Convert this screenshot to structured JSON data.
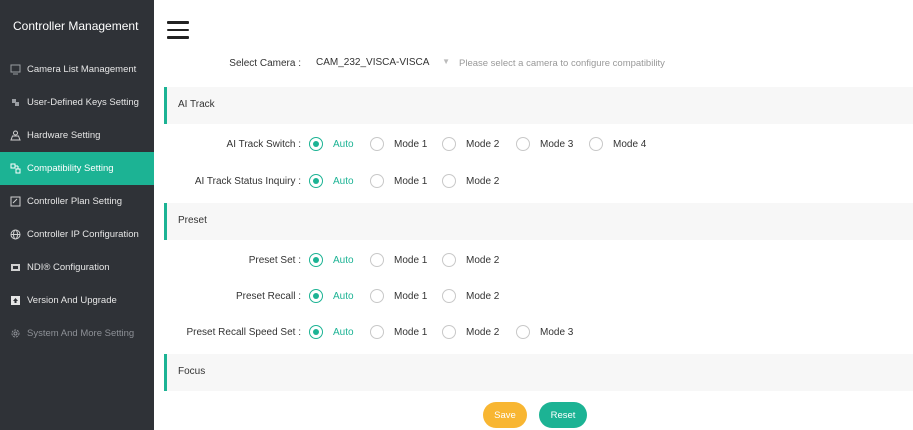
{
  "sidebar": {
    "title": "Controller Management",
    "items": [
      {
        "label": "Camera List Management",
        "icon": "camera-list-icon"
      },
      {
        "label": "User-Defined Keys Setting",
        "icon": "keys-icon"
      },
      {
        "label": "Hardware Setting",
        "icon": "hardware-icon"
      },
      {
        "label": "Compatibility Setting",
        "icon": "compatibility-icon",
        "active": true
      },
      {
        "label": "Controller Plan Setting",
        "icon": "plan-icon"
      },
      {
        "label": "Controller IP Configuration",
        "icon": "ip-icon"
      },
      {
        "label": "NDI® Configuration",
        "icon": "ndi-icon"
      },
      {
        "label": "Version And Upgrade",
        "icon": "upgrade-icon"
      },
      {
        "label": "System And More Setting",
        "icon": "gear-icon"
      }
    ]
  },
  "camera": {
    "label": "Select Camera :",
    "value": "CAM_232_VISCA-VISCA",
    "hint": "Please select a camera to configure compatibility"
  },
  "sections": {
    "ai_track": "AI Track",
    "preset": "Preset",
    "focus": "Focus"
  },
  "rows": {
    "ai_track_switch": {
      "label": "AI Track Switch :",
      "options": [
        "Auto",
        "Mode 1",
        "Mode 2",
        "Mode 3",
        "Mode 4"
      ],
      "selected": "Auto"
    },
    "ai_track_status": {
      "label": "AI Track Status Inquiry :",
      "options": [
        "Auto",
        "Mode 1",
        "Mode 2"
      ],
      "selected": "Auto"
    },
    "preset_set": {
      "label": "Preset Set :",
      "options": [
        "Auto",
        "Mode 1",
        "Mode 2"
      ],
      "selected": "Auto"
    },
    "preset_recall": {
      "label": "Preset Recall :",
      "options": [
        "Auto",
        "Mode 1",
        "Mode 2"
      ],
      "selected": "Auto"
    },
    "preset_recall_speed": {
      "label": "Preset Recall Speed Set :",
      "options": [
        "Auto",
        "Mode 1",
        "Mode 2",
        "Mode 3"
      ],
      "selected": "Auto"
    }
  },
  "buttons": {
    "save": "Save",
    "reset": "Reset"
  },
  "colors": {
    "accent": "#1cb394",
    "save": "#f8b632",
    "sidebar_bg": "#2f3237"
  }
}
